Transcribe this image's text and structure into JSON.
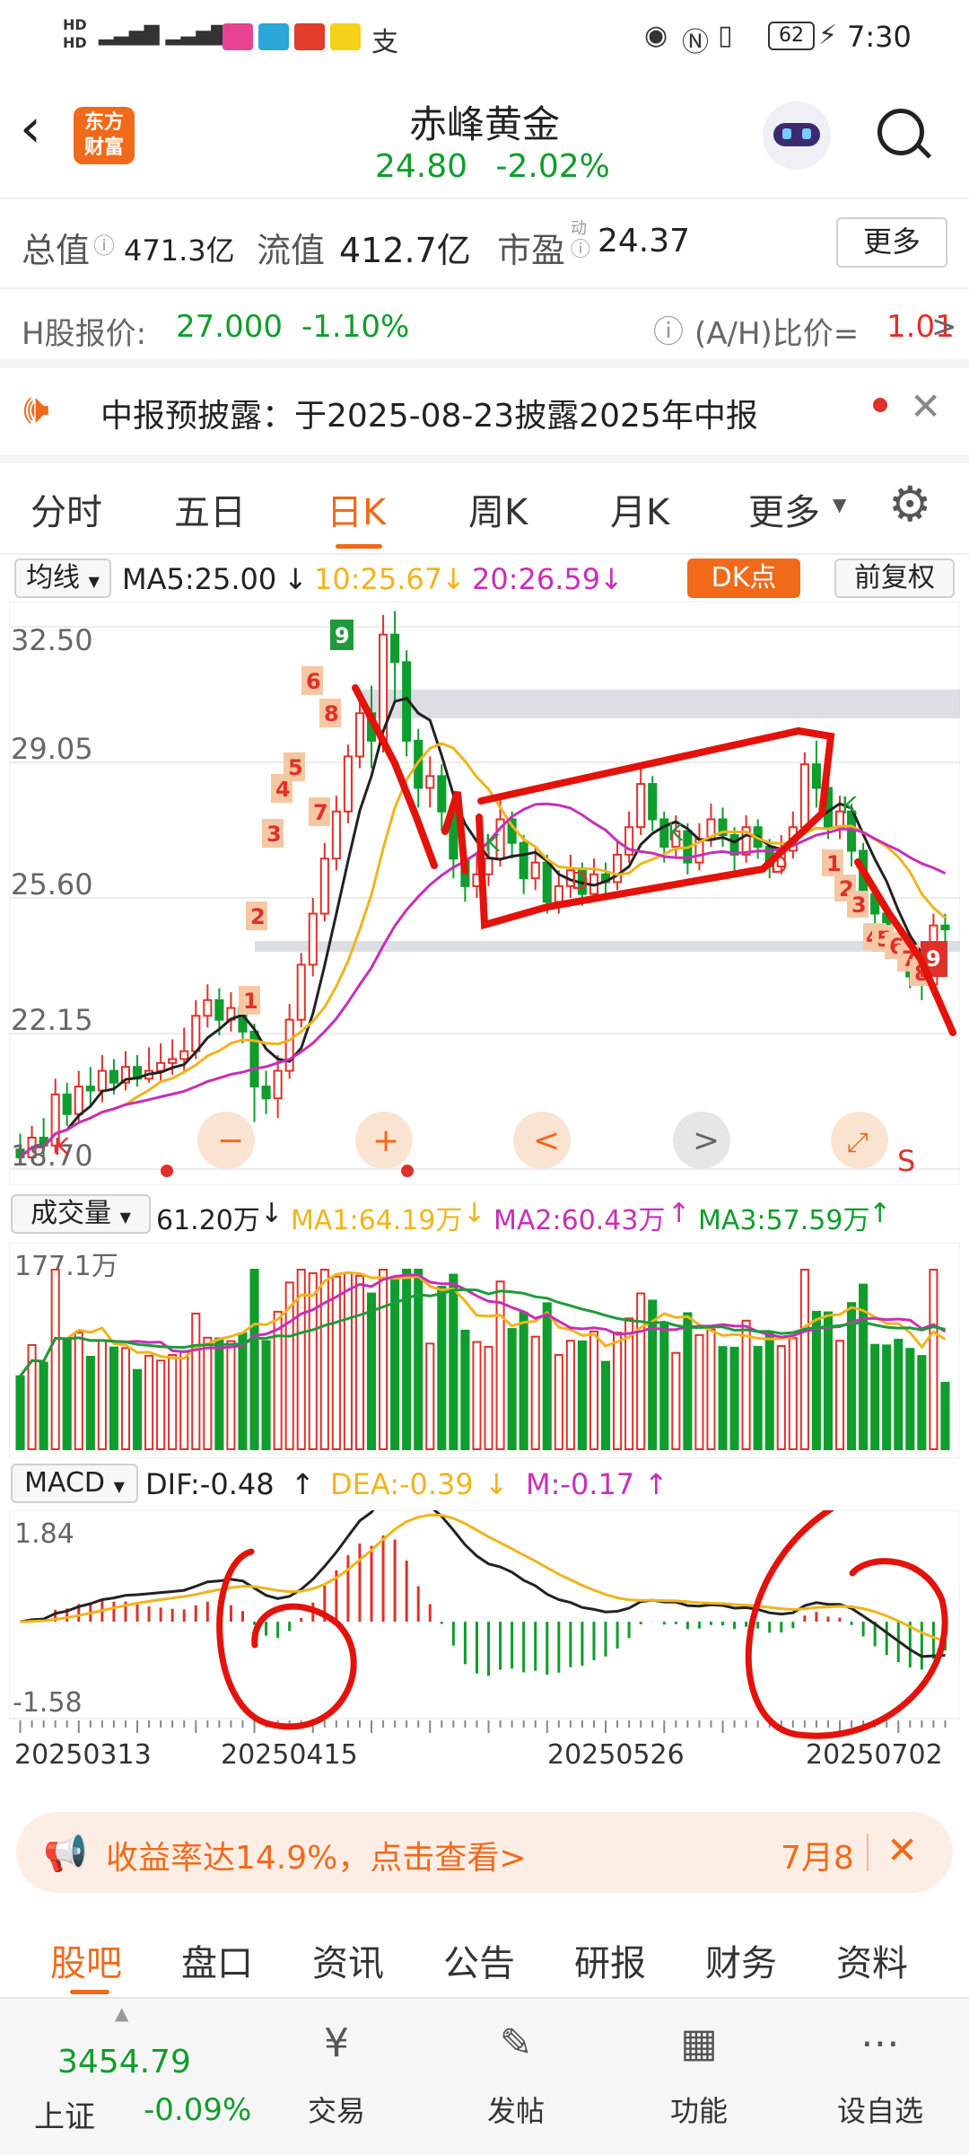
{
  "status_bar": {
    "network_left": "HD 46 46",
    "battery": "62",
    "time": "7:30"
  },
  "header": {
    "logo_line1": "东方",
    "logo_line2": "财富",
    "title": "赤峰黄金",
    "price": "24.80",
    "change_pct": "-2.02%"
  },
  "stats": {
    "total_value_label": "总值",
    "total_value": "471.3亿",
    "float_value_label": "流值",
    "float_value": "412.7亿",
    "pe_label": "市盈",
    "pe_sup": "动",
    "pe_value": "24.37",
    "more_button": "更多"
  },
  "h_share": {
    "label": "H股报价:",
    "price": "27.000",
    "change": "-1.10%",
    "ah_label": "(A/H)比价=",
    "ah_value": "1.01",
    "arrow": ">"
  },
  "notice": {
    "text": "中报预披露：于2025-08-23披露2025年中报"
  },
  "period_tabs": [
    "分时",
    "五日",
    "日K",
    "周K",
    "月K",
    "更多"
  ],
  "active_tab_index": 2,
  "ma_bar": {
    "selector": "均线",
    "ma5": "MA5:25.00",
    "ma10": "10:25.67",
    "ma20": "20:26.59",
    "dk_button": "DK点",
    "adjust_button": "前复权"
  },
  "price_axis": [
    "32.50",
    "29.05",
    "25.60",
    "22.15",
    "18.70"
  ],
  "chart_controls": [
    "−",
    "+",
    "<",
    ">",
    "S"
  ],
  "volume_bar": {
    "selector": "成交量",
    "vol": "61.20万",
    "ma1": "MA1:64.19万",
    "ma2": "MA2:60.43万",
    "ma3": "MA3:57.59万",
    "axis_top": "177.1万"
  },
  "macd_bar": {
    "selector": "MACD",
    "dif": "DIF:-0.48",
    "dea": "DEA:-0.39",
    "m": "M:-0.17",
    "axis_top": "1.84",
    "axis_bottom": "-1.58"
  },
  "date_axis": [
    "20250313",
    "20250415",
    "20250526",
    "20250702"
  ],
  "promo": {
    "text": "收益率达14.9%，点击查看>",
    "date": "7月8"
  },
  "section_tabs": [
    "股吧",
    "盘口",
    "资讯",
    "公告",
    "研报",
    "财务",
    "资料"
  ],
  "bottom_nav": {
    "index_value": "3454.79",
    "index_name": "上证",
    "index_change": "-0.09%",
    "items": [
      "交易",
      "发帖",
      "功能",
      "设自选"
    ]
  },
  "colors": {
    "up": "#e0302a",
    "down": "#0f9d2c",
    "accent": "#f06a1a",
    "ma10": "#f0b41c",
    "ma20": "#c72fb8"
  },
  "chart_data": [
    {
      "type": "candlestick",
      "title": "日K",
      "ylim": [
        18.7,
        32.5
      ],
      "yticks": [
        32.5,
        29.05,
        25.6,
        22.15,
        18.7
      ],
      "x_labels": [
        "20250313",
        "20250415",
        "20250526",
        "20250702"
      ],
      "candles": [
        [
          19.2,
          19.0,
          19.6,
          18.8
        ],
        [
          19.0,
          19.5,
          19.8,
          18.9
        ],
        [
          19.5,
          19.3,
          20.0,
          19.0
        ],
        [
          19.3,
          20.6,
          21.0,
          19.1
        ],
        [
          20.6,
          20.1,
          20.9,
          19.8
        ],
        [
          20.1,
          20.8,
          21.2,
          19.9
        ],
        [
          20.8,
          20.7,
          21.3,
          20.3
        ],
        [
          20.7,
          21.2,
          21.6,
          20.4
        ],
        [
          21.2,
          20.9,
          21.5,
          20.6
        ],
        [
          20.9,
          21.3,
          21.7,
          20.7
        ],
        [
          21.3,
          21.0,
          21.6,
          20.8
        ],
        [
          21.0,
          21.2,
          21.8,
          20.9
        ],
        [
          21.2,
          21.4,
          21.9,
          20.9
        ],
        [
          21.4,
          21.5,
          22.0,
          21.1
        ],
        [
          21.5,
          21.7,
          22.3,
          21.2
        ],
        [
          21.7,
          22.6,
          23.0,
          21.5
        ],
        [
          22.6,
          23.0,
          23.4,
          22.3
        ],
        [
          23.0,
          22.5,
          23.3,
          22.1
        ],
        [
          22.5,
          22.8,
          23.2,
          22.2
        ],
        [
          22.8,
          22.2,
          23.0,
          21.9
        ],
        [
          22.2,
          20.8,
          22.4,
          19.9
        ],
        [
          20.8,
          20.5,
          21.2,
          20.1
        ],
        [
          20.5,
          21.2,
          21.6,
          20.0
        ],
        [
          21.2,
          22.5,
          22.9,
          21.0
        ],
        [
          22.5,
          23.9,
          24.2,
          22.3
        ],
        [
          23.9,
          25.2,
          25.6,
          23.6
        ],
        [
          25.2,
          26.6,
          27.0,
          25.0
        ],
        [
          26.6,
          27.8,
          28.2,
          26.3
        ],
        [
          27.8,
          29.2,
          29.5,
          27.5
        ],
        [
          29.2,
          30.3,
          30.8,
          28.9
        ],
        [
          30.3,
          29.6,
          31.0,
          28.9
        ],
        [
          29.6,
          32.3,
          32.8,
          29.3
        ],
        [
          32.3,
          31.6,
          32.9,
          30.6
        ],
        [
          31.6,
          29.6,
          31.9,
          29.2
        ],
        [
          29.6,
          28.4,
          29.9,
          27.9
        ],
        [
          28.4,
          28.7,
          29.2,
          27.9
        ],
        [
          28.7,
          27.8,
          29.0,
          27.3
        ],
        [
          27.8,
          26.6,
          28.0,
          26.1
        ],
        [
          26.6,
          25.9,
          26.8,
          25.5
        ],
        [
          25.9,
          26.2,
          26.7,
          25.6
        ],
        [
          26.2,
          26.6,
          27.0,
          25.9
        ],
        [
          26.6,
          27.6,
          28.1,
          26.4
        ],
        [
          27.6,
          27.0,
          27.8,
          26.6
        ],
        [
          27.0,
          26.1,
          27.2,
          25.7
        ],
        [
          26.1,
          26.5,
          26.9,
          25.8
        ],
        [
          26.5,
          25.5,
          26.7,
          25.2
        ],
        [
          25.5,
          25.9,
          26.3,
          25.2
        ],
        [
          25.9,
          26.3,
          26.7,
          25.6
        ],
        [
          26.3,
          25.7,
          26.5,
          25.4
        ],
        [
          25.7,
          26.2,
          26.6,
          25.5
        ],
        [
          26.2,
          26.0,
          26.5,
          25.6
        ],
        [
          26.0,
          26.7,
          27.1,
          25.8
        ],
        [
          26.7,
          27.4,
          27.8,
          26.5
        ],
        [
          27.4,
          28.5,
          28.9,
          27.2
        ],
        [
          28.5,
          27.6,
          28.7,
          27.3
        ],
        [
          27.6,
          26.9,
          27.8,
          26.5
        ],
        [
          26.9,
          27.3,
          27.7,
          26.6
        ],
        [
          27.3,
          26.5,
          27.5,
          26.2
        ],
        [
          26.5,
          27.1,
          27.5,
          26.3
        ],
        [
          27.1,
          27.6,
          28.0,
          26.9
        ],
        [
          27.6,
          27.2,
          27.9,
          26.9
        ],
        [
          27.2,
          26.7,
          27.4,
          26.3
        ],
        [
          26.7,
          27.4,
          27.7,
          26.5
        ],
        [
          27.4,
          26.9,
          27.6,
          26.6
        ],
        [
          26.9,
          26.4,
          27.1,
          26.1
        ],
        [
          26.4,
          26.8,
          27.2,
          26.2
        ],
        [
          26.8,
          27.4,
          27.8,
          26.6
        ],
        [
          27.4,
          29.0,
          29.3,
          27.2
        ],
        [
          29.0,
          28.4,
          29.6,
          27.9
        ],
        [
          28.4,
          27.4,
          28.6,
          27.1
        ],
        [
          27.4,
          27.8,
          28.2,
          27.1
        ],
        [
          27.8,
          26.8,
          28.0,
          26.4
        ],
        [
          26.8,
          25.7,
          27.0,
          25.4
        ],
        [
          25.7,
          25.2,
          25.9,
          24.9
        ],
        [
          25.2,
          24.6,
          25.4,
          24.3
        ],
        [
          24.6,
          24.1,
          24.8,
          23.8
        ],
        [
          24.1,
          23.6,
          24.3,
          23.3
        ],
        [
          23.6,
          23.4,
          23.8,
          23.0
        ],
        [
          23.4,
          24.9,
          25.2,
          23.3
        ],
        [
          24.9,
          24.8,
          25.2,
          24.5
        ]
      ],
      "ma": {
        "MA5": 25.0,
        "MA10": 25.67,
        "MA20": 26.59
      }
    },
    {
      "type": "bar",
      "title": "成交量",
      "ylim": [
        0,
        177.1
      ],
      "unit": "万",
      "last_value": 61.2,
      "ma": {
        "MA1": 64.19,
        "MA2": 60.43,
        "MA3": 57.59
      }
    },
    {
      "type": "line",
      "title": "MACD",
      "ylim": [
        -1.58,
        1.84
      ],
      "values": {
        "DIF": -0.48,
        "DEA": -0.39,
        "M": -0.17
      }
    }
  ]
}
